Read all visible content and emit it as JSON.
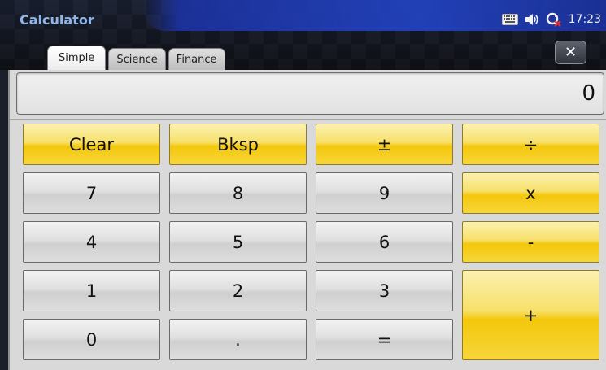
{
  "app": {
    "title": "Calculator"
  },
  "status_bar": {
    "time": "17:23",
    "icons": [
      "keyboard-icon",
      "speaker-icon",
      "network-disconnected-icon"
    ]
  },
  "tabs": [
    {
      "label": "Simple",
      "active": true
    },
    {
      "label": "Science",
      "active": false
    },
    {
      "label": "Finance",
      "active": false
    }
  ],
  "close_label": "✕",
  "display": {
    "value": "0"
  },
  "keys": {
    "clear": "Clear",
    "bksp": "Bksp",
    "plus_minus": "±",
    "divide": "÷",
    "seven": "7",
    "eight": "8",
    "nine": "9",
    "multiply": "x",
    "four": "4",
    "five": "5",
    "six": "6",
    "minus": "-",
    "one": "1",
    "two": "2",
    "three": "3",
    "plus": "+",
    "zero": "0",
    "dot": ".",
    "equals": "="
  },
  "colors": {
    "operator_key": "#f4c70c",
    "number_key": "#e0e0e0",
    "title_text": "#8fb6e8",
    "title_bar_accent": "#2242be"
  }
}
